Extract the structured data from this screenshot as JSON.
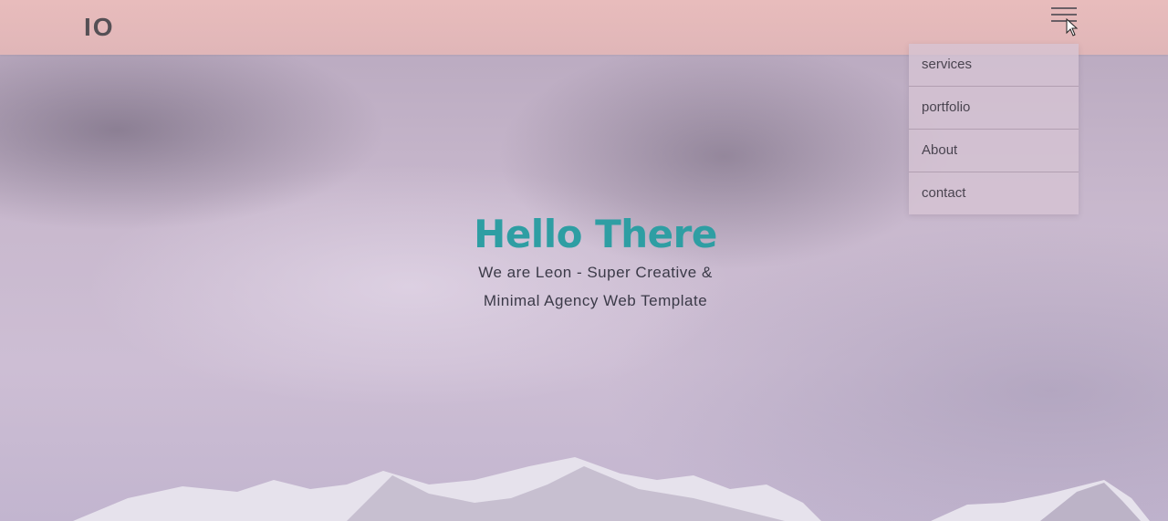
{
  "header": {
    "logo": "IO",
    "menu_icon": "hamburger-menu-icon"
  },
  "nav_menu": {
    "items": [
      {
        "label": "services"
      },
      {
        "label": "portfolio"
      },
      {
        "label": "About"
      },
      {
        "label": "contact"
      }
    ]
  },
  "hero": {
    "title": "Hello There",
    "subtitle_line1": "We are Leon - Super Creative &",
    "subtitle_line2": "Minimal Agency Web Template"
  },
  "colors": {
    "header_bg": "#e8bcbc",
    "title": "#2e9ea3",
    "text": "#3b3a48"
  }
}
